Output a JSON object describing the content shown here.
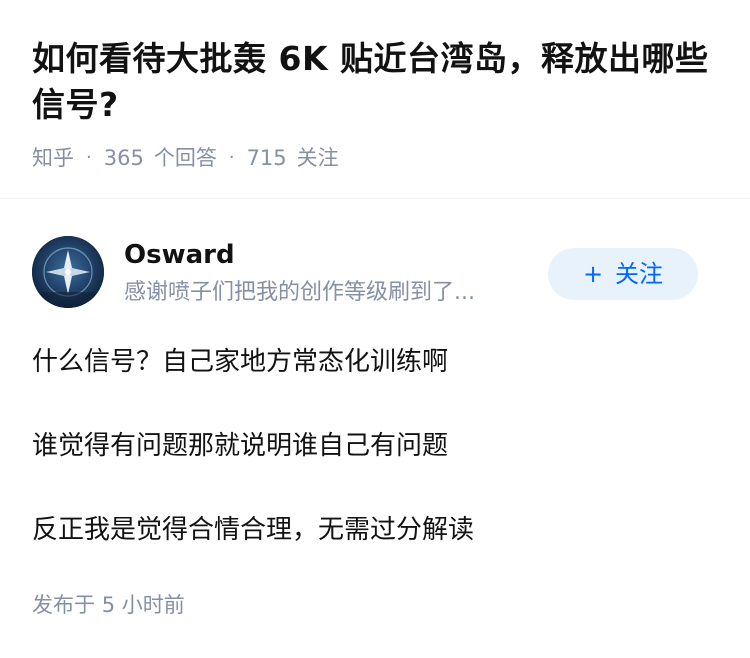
{
  "question": {
    "title": "如何看待大批轰 6K 贴近台湾岛，释放出哪些信号?",
    "source": "知乎",
    "answer_count": "365",
    "answer_label": "个回答",
    "follower_count": "715",
    "follower_label": "关注"
  },
  "author": {
    "name": "Osward",
    "bio": "感谢喷子们把我的创作等级刷到了...",
    "follow_label": "关注",
    "follow_icon": "plus-icon"
  },
  "answer": {
    "paragraphs": [
      "什么信号？自己家地方常态化训练啊",
      "谁觉得有问题那就说明谁自己有问题",
      "反正我是觉得合情合理，无需过分解读"
    ],
    "publish_prefix": "发布于",
    "publish_time": "5 小时前"
  },
  "colors": {
    "text_primary": "#121212",
    "text_secondary": "#8590a6",
    "accent": "#0066ff",
    "follow_bg": "#e8f2fd"
  }
}
